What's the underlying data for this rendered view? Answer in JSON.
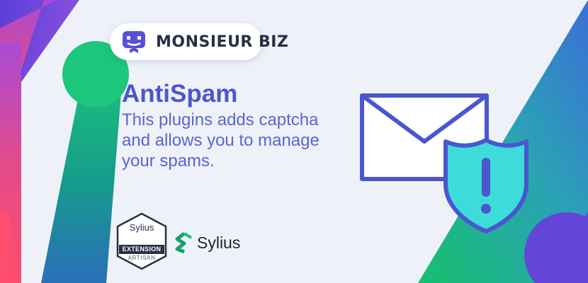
{
  "logo": {
    "text": "MONSIEUR BIZ"
  },
  "headline": {
    "title": "AntiSpam",
    "description": [
      "This plugins adds captcha",
      "and allows you to manage",
      "your spams."
    ]
  },
  "badge": {
    "line1": "Sylius",
    "line2": "EXTENSION",
    "line3": "ARTISAN"
  },
  "partner": {
    "name": "Sylius"
  },
  "icons": [
    "monsieur-biz-logo-icon",
    "envelope-icon",
    "shield-alert-icon",
    "sylius-logo-icon"
  ],
  "colors": {
    "background": "#eef2f8",
    "accent_text": "#4a56cf",
    "illustration_stroke": "#4a56cf",
    "shield_fill": "#3ddbd9",
    "sylius_green": "#1a9f6a"
  }
}
